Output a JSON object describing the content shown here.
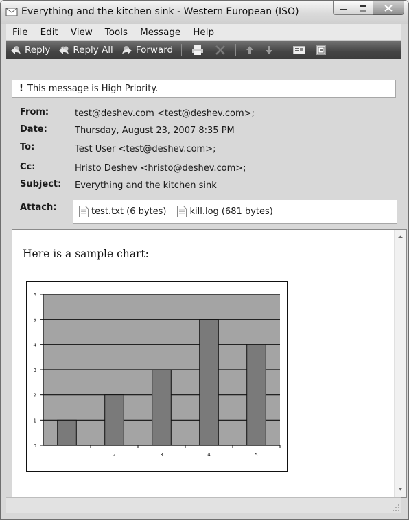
{
  "window": {
    "title": "Everything and the kitchen sink - Western European (ISO)"
  },
  "menu": [
    "File",
    "Edit",
    "View",
    "Tools",
    "Message",
    "Help"
  ],
  "toolbar": {
    "reply": "Reply",
    "reply_all": "Reply All",
    "forward": "Forward"
  },
  "priority_notice": "This message is High Priority.",
  "headers": {
    "from_label": "From:",
    "from": "test@deshev.com <test@deshev.com>;",
    "date_label": "Date:",
    "date": "Thursday, August 23, 2007 8:35 PM",
    "to_label": "To:",
    "to": "Test User <test@deshev.com>;",
    "cc_label": "Cc:",
    "cc": "Hristo Deshev <hristo@deshev.com>;",
    "subject_label": "Subject:",
    "subject": "Everything and the kitchen sink",
    "attach_label": "Attach:"
  },
  "attachments": [
    {
      "name": "test.txt (6 bytes)"
    },
    {
      "name": "kill.log (681 bytes)"
    }
  ],
  "body": {
    "text": "Here is a sample chart:"
  },
  "chart_data": {
    "type": "bar",
    "categories": [
      "1",
      "2",
      "3",
      "4",
      "5"
    ],
    "values": [
      1,
      2,
      3,
      5,
      4
    ],
    "ylim": [
      0,
      6
    ],
    "yticks": [
      0,
      1,
      2,
      3,
      4,
      5,
      6
    ],
    "grid": true,
    "legend": "none",
    "colors": {
      "plot_background": "#a4a4a4",
      "bar": "#7a7a7a",
      "gridline": "#111111"
    }
  }
}
